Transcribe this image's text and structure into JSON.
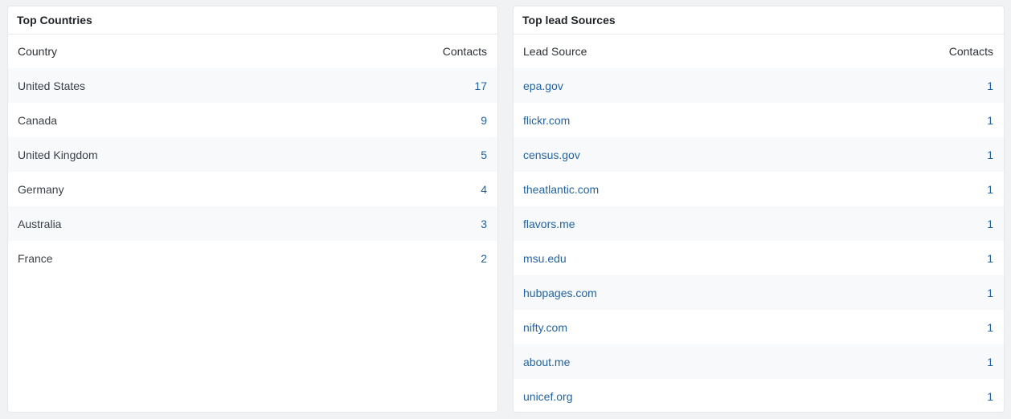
{
  "countries": {
    "title": "Top Countries",
    "col_label": "Country",
    "col_value": "Contacts",
    "rows": [
      {
        "label": "United States",
        "value": "17"
      },
      {
        "label": "Canada",
        "value": "9"
      },
      {
        "label": "United Kingdom",
        "value": "5"
      },
      {
        "label": "Germany",
        "value": "4"
      },
      {
        "label": "Australia",
        "value": "3"
      },
      {
        "label": "France",
        "value": "2"
      }
    ]
  },
  "sources": {
    "title": "Top lead Sources",
    "col_label": "Lead Source",
    "col_value": "Contacts",
    "rows": [
      {
        "label": "epa.gov",
        "value": "1"
      },
      {
        "label": "flickr.com",
        "value": "1"
      },
      {
        "label": "census.gov",
        "value": "1"
      },
      {
        "label": "theatlantic.com",
        "value": "1"
      },
      {
        "label": "flavors.me",
        "value": "1"
      },
      {
        "label": "msu.edu",
        "value": "1"
      },
      {
        "label": "hubpages.com",
        "value": "1"
      },
      {
        "label": "nifty.com",
        "value": "1"
      },
      {
        "label": "about.me",
        "value": "1"
      },
      {
        "label": "unicef.org",
        "value": "1"
      }
    ]
  },
  "colors": {
    "link": "#2463a3",
    "stripe": "#f7f9fb",
    "background": "#f1f2f4"
  }
}
